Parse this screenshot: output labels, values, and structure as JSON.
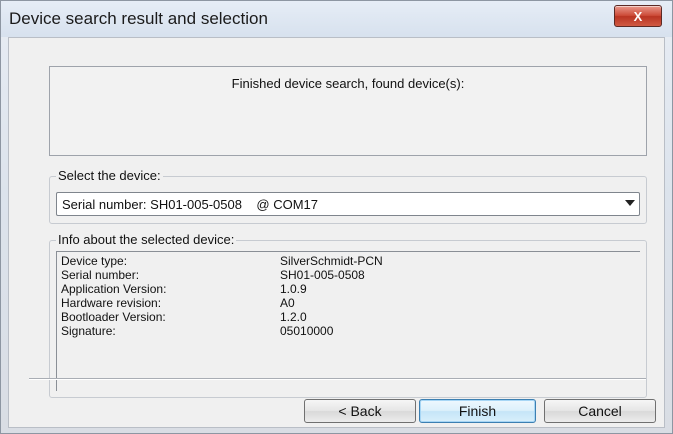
{
  "window": {
    "title": "Device search result and selection",
    "close_glyph": "X"
  },
  "message": "Finished device search, found device(s):",
  "select": {
    "label": "Select the device:",
    "value": "Serial number: SH01-005-0508    @ COM17"
  },
  "info": {
    "label": "Info about the selected device:",
    "rows": [
      {
        "key": "Device type:",
        "value": "SilverSchmidt-PCN"
      },
      {
        "key": "Serial number:",
        "value": "SH01-005-0508"
      },
      {
        "key": "Application Version:",
        "value": "1.0.9"
      },
      {
        "key": "Hardware revision:",
        "value": "A0"
      },
      {
        "key": "Bootloader Version:",
        "value": "1.2.0"
      },
      {
        "key": "Signature:",
        "value": "05010000"
      }
    ]
  },
  "buttons": {
    "back": "< Back",
    "finish": "Finish",
    "cancel": "Cancel"
  }
}
